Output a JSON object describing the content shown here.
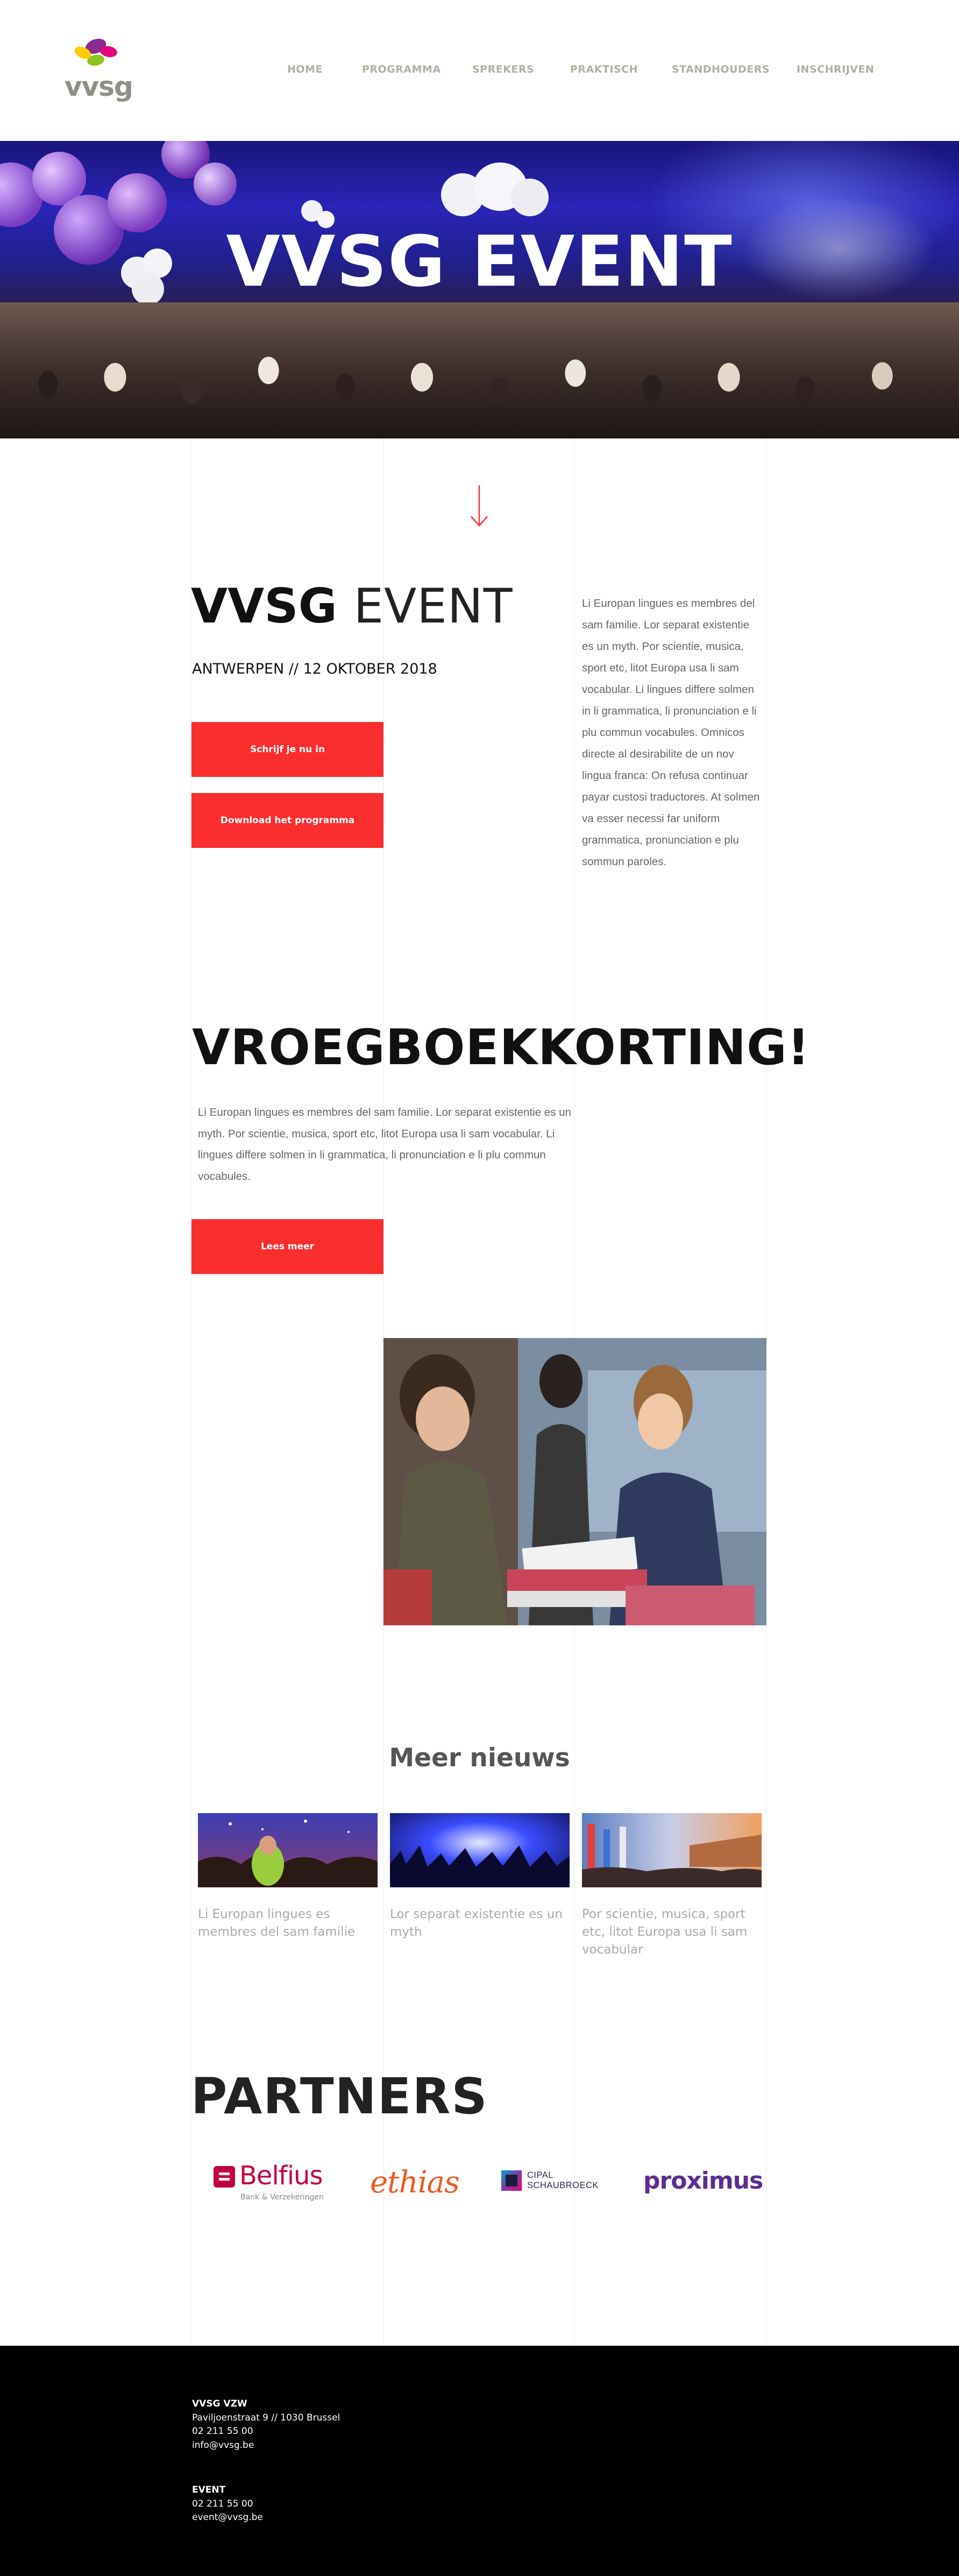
{
  "logo": {
    "text": "vvsg",
    "icon": "vvsg-flower-logo"
  },
  "nav": {
    "items": [
      {
        "label": "HOME"
      },
      {
        "label": "PROGRAMMA"
      },
      {
        "label": "SPREKERS"
      },
      {
        "label": "PRAKTISCH"
      },
      {
        "label": "STANDHOUDERS"
      },
      {
        "label": "INSCHRIJVEN"
      }
    ]
  },
  "hero": {
    "title": "VVSG EVENT"
  },
  "scroll": {
    "icon": "arrow-down-icon"
  },
  "intro": {
    "title_bold": "VVSG",
    "title_light": "EVENT",
    "subtitle": "ANTWERPEN // 12 OKTOBER 2018",
    "button_register": "Schrijf je nu in",
    "button_program": "Download het programma",
    "body": "Li Europan lingues es membres del sam familie. Lor separat existentie es un myth. Por scientie, musica, sport etc, litot Europa usa li sam vocabular. Li lingues differe solmen in li grammatica, li pronunciation e li plu commun vocabules. Omnicos directe al desirabilite de un nov lingua franca: On refusa continuar payar custosi traductores. At solmen va esser necessi far uniform grammatica, pronunciation e plu sommun paroles."
  },
  "earlybird": {
    "title": "VROEGBOEKKORTING!",
    "body": "Li Europan lingues es membres del sam familie. Lor separat existentie es un myth. Por scientie, musica, sport etc, litot Europa usa li sam vocabular. Li lingues differe solmen in li grammatica, li pronunciation e li plu commun vocabules.",
    "button": "Lees meer"
  },
  "news": {
    "heading": "Meer nieuws",
    "items": [
      {
        "text": "Li Europan lingues es membres del sam familie"
      },
      {
        "text": "Lor separat existentie es un myth"
      },
      {
        "text": "Por scientie, musica, sport etc, litot Europa usa li sam vocabular"
      }
    ]
  },
  "partners": {
    "heading": "PARTNERS",
    "items": [
      {
        "name": "Belfius",
        "tagline": "Bank & Verzekeringen",
        "color": "#c30045"
      },
      {
        "name": "ethias",
        "color": "#ec5a24"
      },
      {
        "name": "CIPAL SCHAUBROECK",
        "color": "#2a2a4a"
      },
      {
        "name": "proximus",
        "color": "#5c2d91"
      }
    ]
  },
  "footer": {
    "org": {
      "title": "VVSG VZW",
      "address": "Paviljoenstraat 9 // 1030 Brussel",
      "phone": "02 211 55 00",
      "email": "info@vvsg.be"
    },
    "event": {
      "title": "EVENT",
      "phone": "02 211 55 00",
      "email": "event@vvsg.be"
    }
  },
  "colors": {
    "accent": "#fa2d2f",
    "nav": "#b0aea3",
    "footer_bg": "#000000"
  }
}
